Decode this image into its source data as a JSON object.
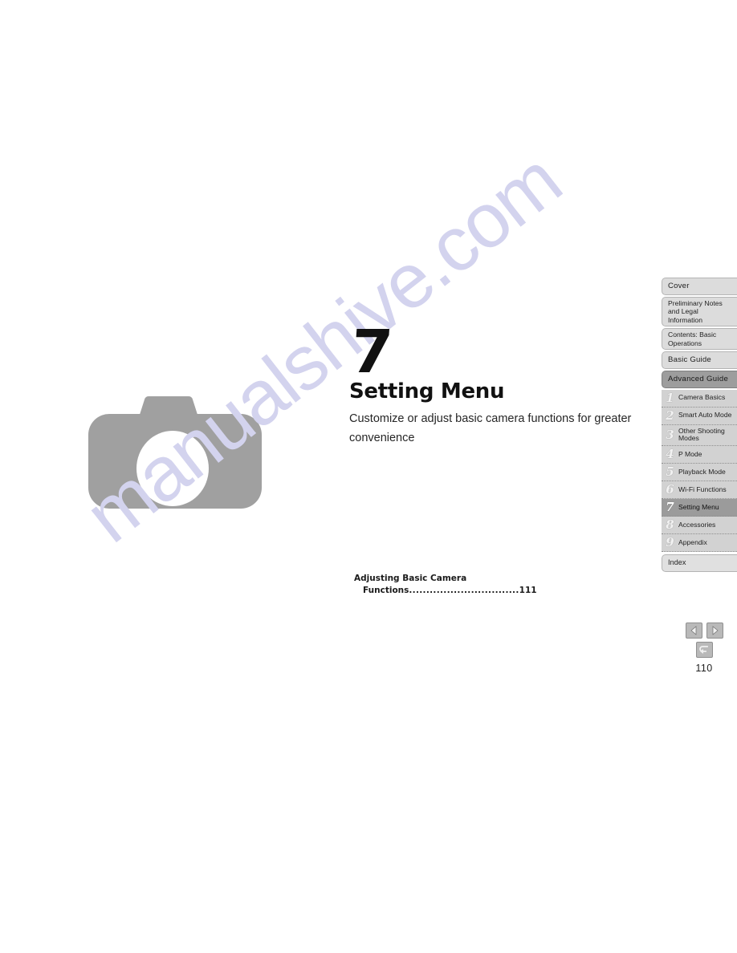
{
  "page": {
    "number": "110",
    "background_color": "#ffffff"
  },
  "watermark": {
    "text": "manualshive.com",
    "color": "#d3d3ee"
  },
  "chapter": {
    "number": "7",
    "title": "Setting Menu",
    "description": "Customize or adjust basic camera functions for greater convenience"
  },
  "illustration": {
    "icon": "camera-icon",
    "body_color": "#a0a0a0",
    "lens_color": "#ffffff"
  },
  "mini_toc": {
    "entry_line1": "Adjusting Basic Camera",
    "entry_line2": "Functions",
    "leader": "................................",
    "entry_page": "111"
  },
  "sidebar": {
    "top_tabs": [
      {
        "label": "Cover",
        "style": "big"
      },
      {
        "label": "Preliminary Notes and Legal Information",
        "style": "two-line"
      },
      {
        "label": "Contents: Basic Operations",
        "style": "two-line"
      },
      {
        "label": "Basic Guide",
        "style": "big"
      }
    ],
    "group_head": {
      "label": "Advanced Guide"
    },
    "chapters": [
      {
        "num": "1",
        "label": "Camera Basics",
        "active": false
      },
      {
        "num": "2",
        "label": "Smart Auto Mode",
        "active": false
      },
      {
        "num": "3",
        "label": "Other Shooting Modes",
        "active": false
      },
      {
        "num": "4",
        "label": "P Mode",
        "active": false
      },
      {
        "num": "5",
        "label": "Playback Mode",
        "active": false
      },
      {
        "num": "6",
        "label": "Wi-Fi Functions",
        "active": false
      },
      {
        "num": "7",
        "label": "Setting Menu",
        "active": true
      },
      {
        "num": "8",
        "label": "Accessories",
        "active": false
      },
      {
        "num": "9",
        "label": "Appendix",
        "active": false
      }
    ],
    "index_tab": {
      "label": "Index"
    }
  },
  "nav": {
    "previous": "previous-page",
    "next": "next-page",
    "back": "return-back",
    "button_color": "#b9b9b9"
  }
}
